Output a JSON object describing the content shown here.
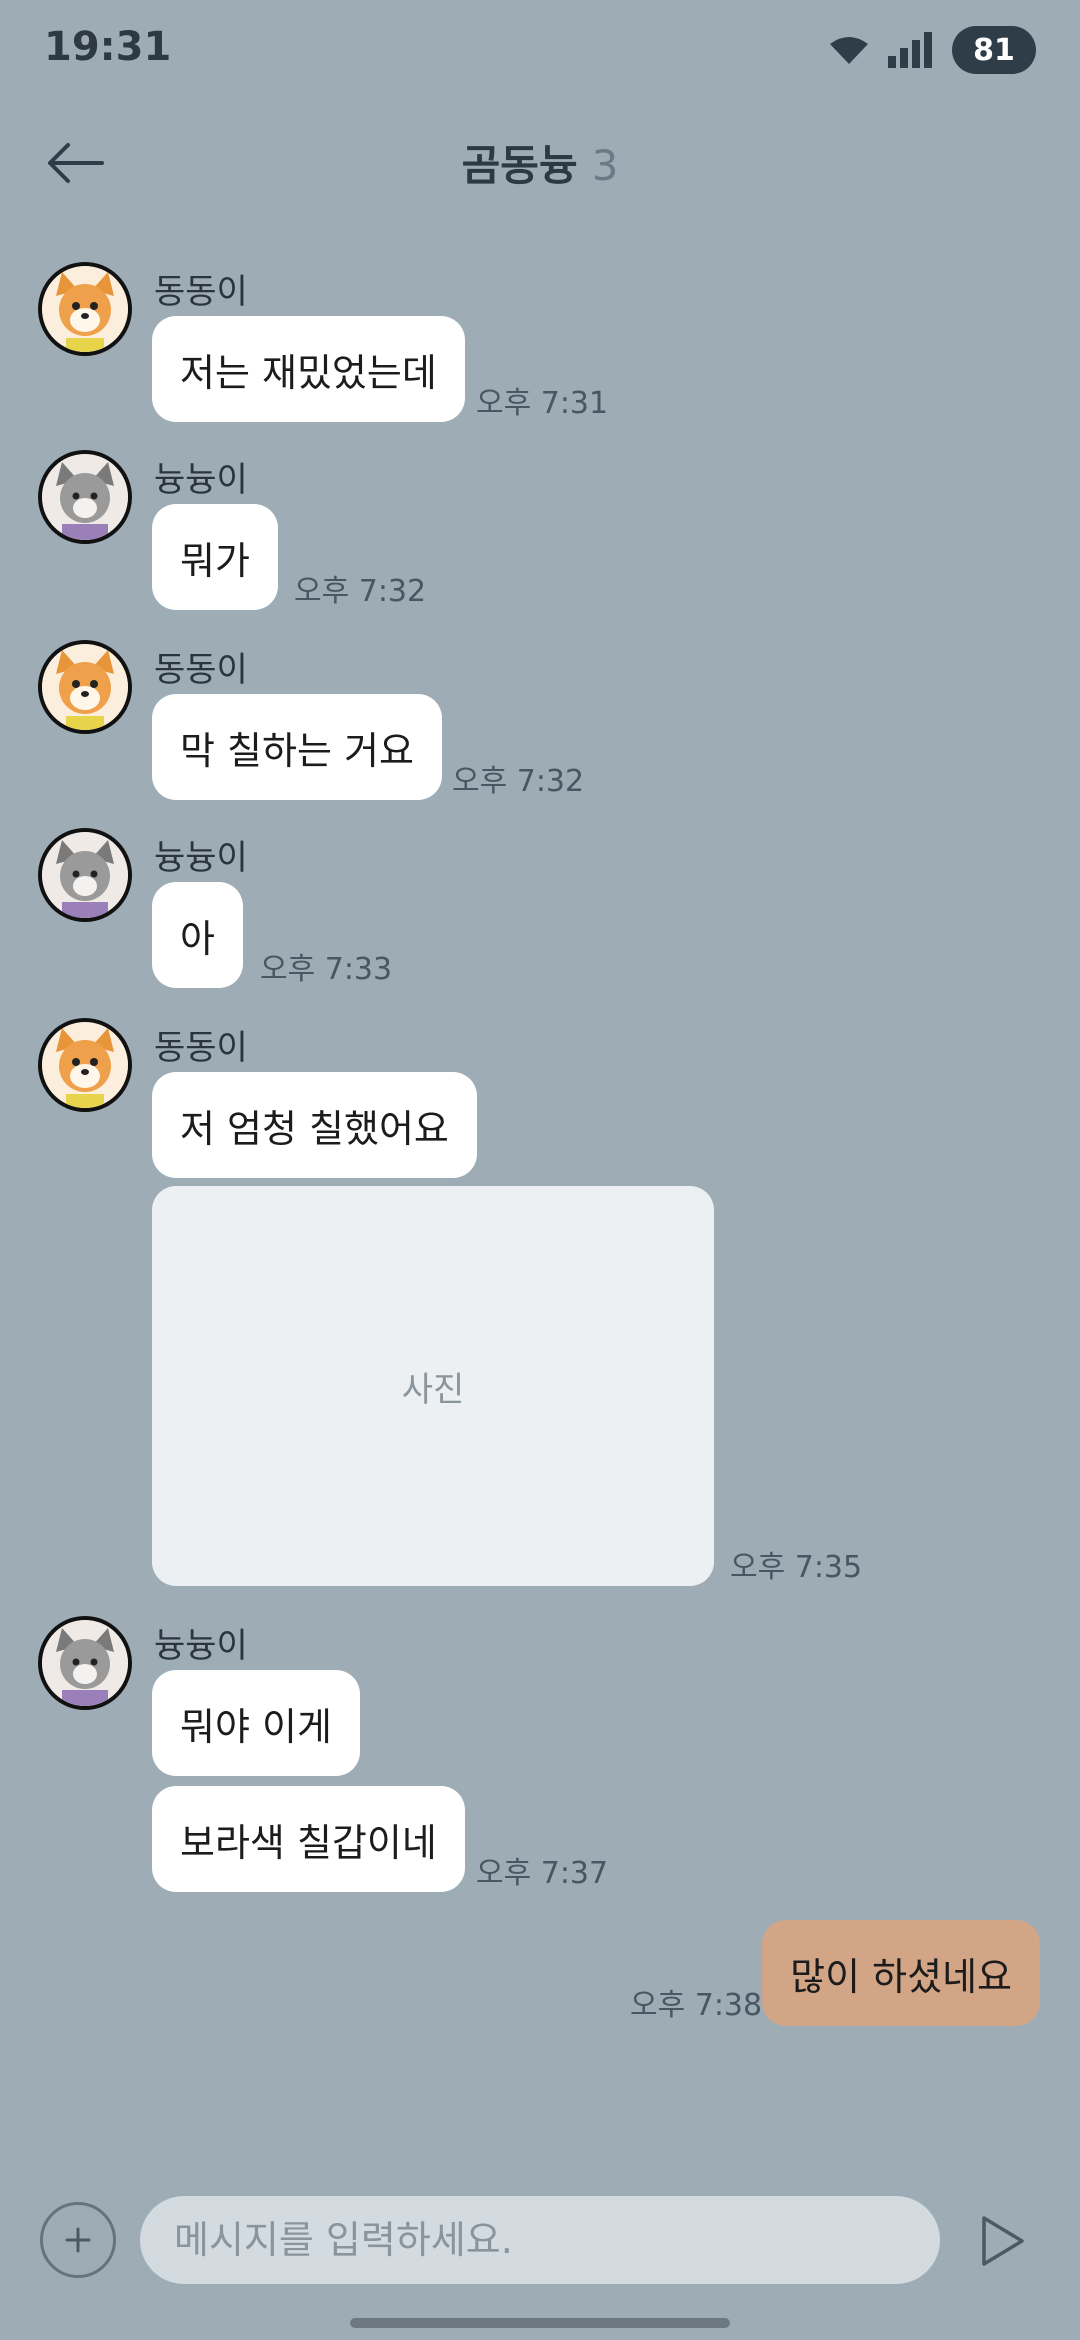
{
  "status": {
    "time": "19:31",
    "battery": "81"
  },
  "header": {
    "title": "곰동늉",
    "member_count": "3"
  },
  "messages": [
    {
      "sender": "동동이",
      "text": "저는 재밌었는데",
      "time": "오후 7:31"
    },
    {
      "sender": "늉늉이",
      "text": "뭐가",
      "time": "오후 7:32"
    },
    {
      "sender": "동동이",
      "text": "막 칠하는 거요",
      "time": "오후 7:32"
    },
    {
      "sender": "늉늉이",
      "text": "아",
      "time": "오후 7:33"
    },
    {
      "sender": "동동이",
      "text": "저 엄청 칠했어요",
      "photo_label": "사진",
      "time": "오후 7:35"
    },
    {
      "sender": "늉늉이",
      "text": "뭐야 이게",
      "text2": "보라색 칠갑이네",
      "time": "오후 7:37"
    }
  ],
  "mine": {
    "text": "많이 하셨네요",
    "time": "오후 7:38"
  },
  "composer": {
    "placeholder": "메시지를 입력하세요."
  },
  "colors": {
    "background": "#9eacb6",
    "my_bubble": "#d2a586",
    "other_bubble": "#ffffff"
  }
}
